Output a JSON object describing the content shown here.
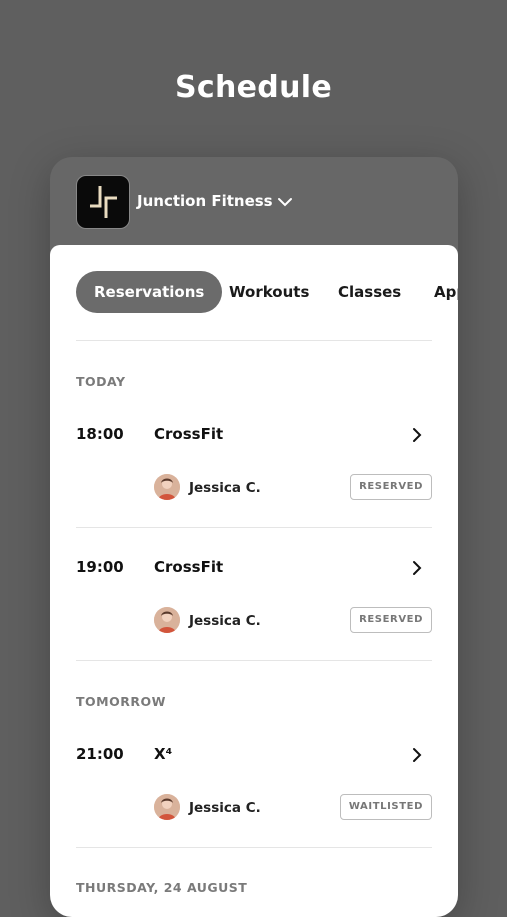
{
  "page": {
    "title": "Schedule"
  },
  "gym": {
    "name": "Junction Fitness"
  },
  "tabs": [
    {
      "label": "Reservations",
      "active": true
    },
    {
      "label": "Workouts",
      "active": false
    },
    {
      "label": "Classes",
      "active": false
    },
    {
      "label": "App",
      "active": false
    }
  ],
  "sections": [
    {
      "label": "TODAY",
      "items": [
        {
          "time": "18:00",
          "class": "CrossFit",
          "coach": "Jessica C.",
          "status": "RESERVED"
        },
        {
          "time": "19:00",
          "class": "CrossFit",
          "coach": "Jessica C.",
          "status": "RESERVED"
        }
      ]
    },
    {
      "label": "TOMORROW",
      "items": [
        {
          "time": "21:00",
          "class": "X⁴",
          "coach": "Jessica C.",
          "status": "WAITLISTED"
        }
      ]
    },
    {
      "label": "THURSDAY, 24 AUGUST",
      "items": []
    }
  ],
  "colors": {
    "background": "#5f5f5f",
    "active_tab": "#6b6b6b",
    "sheet": "#ffffff"
  },
  "icons": {
    "dropdown": "chevron-down-icon",
    "row": "chevron-right-icon"
  }
}
